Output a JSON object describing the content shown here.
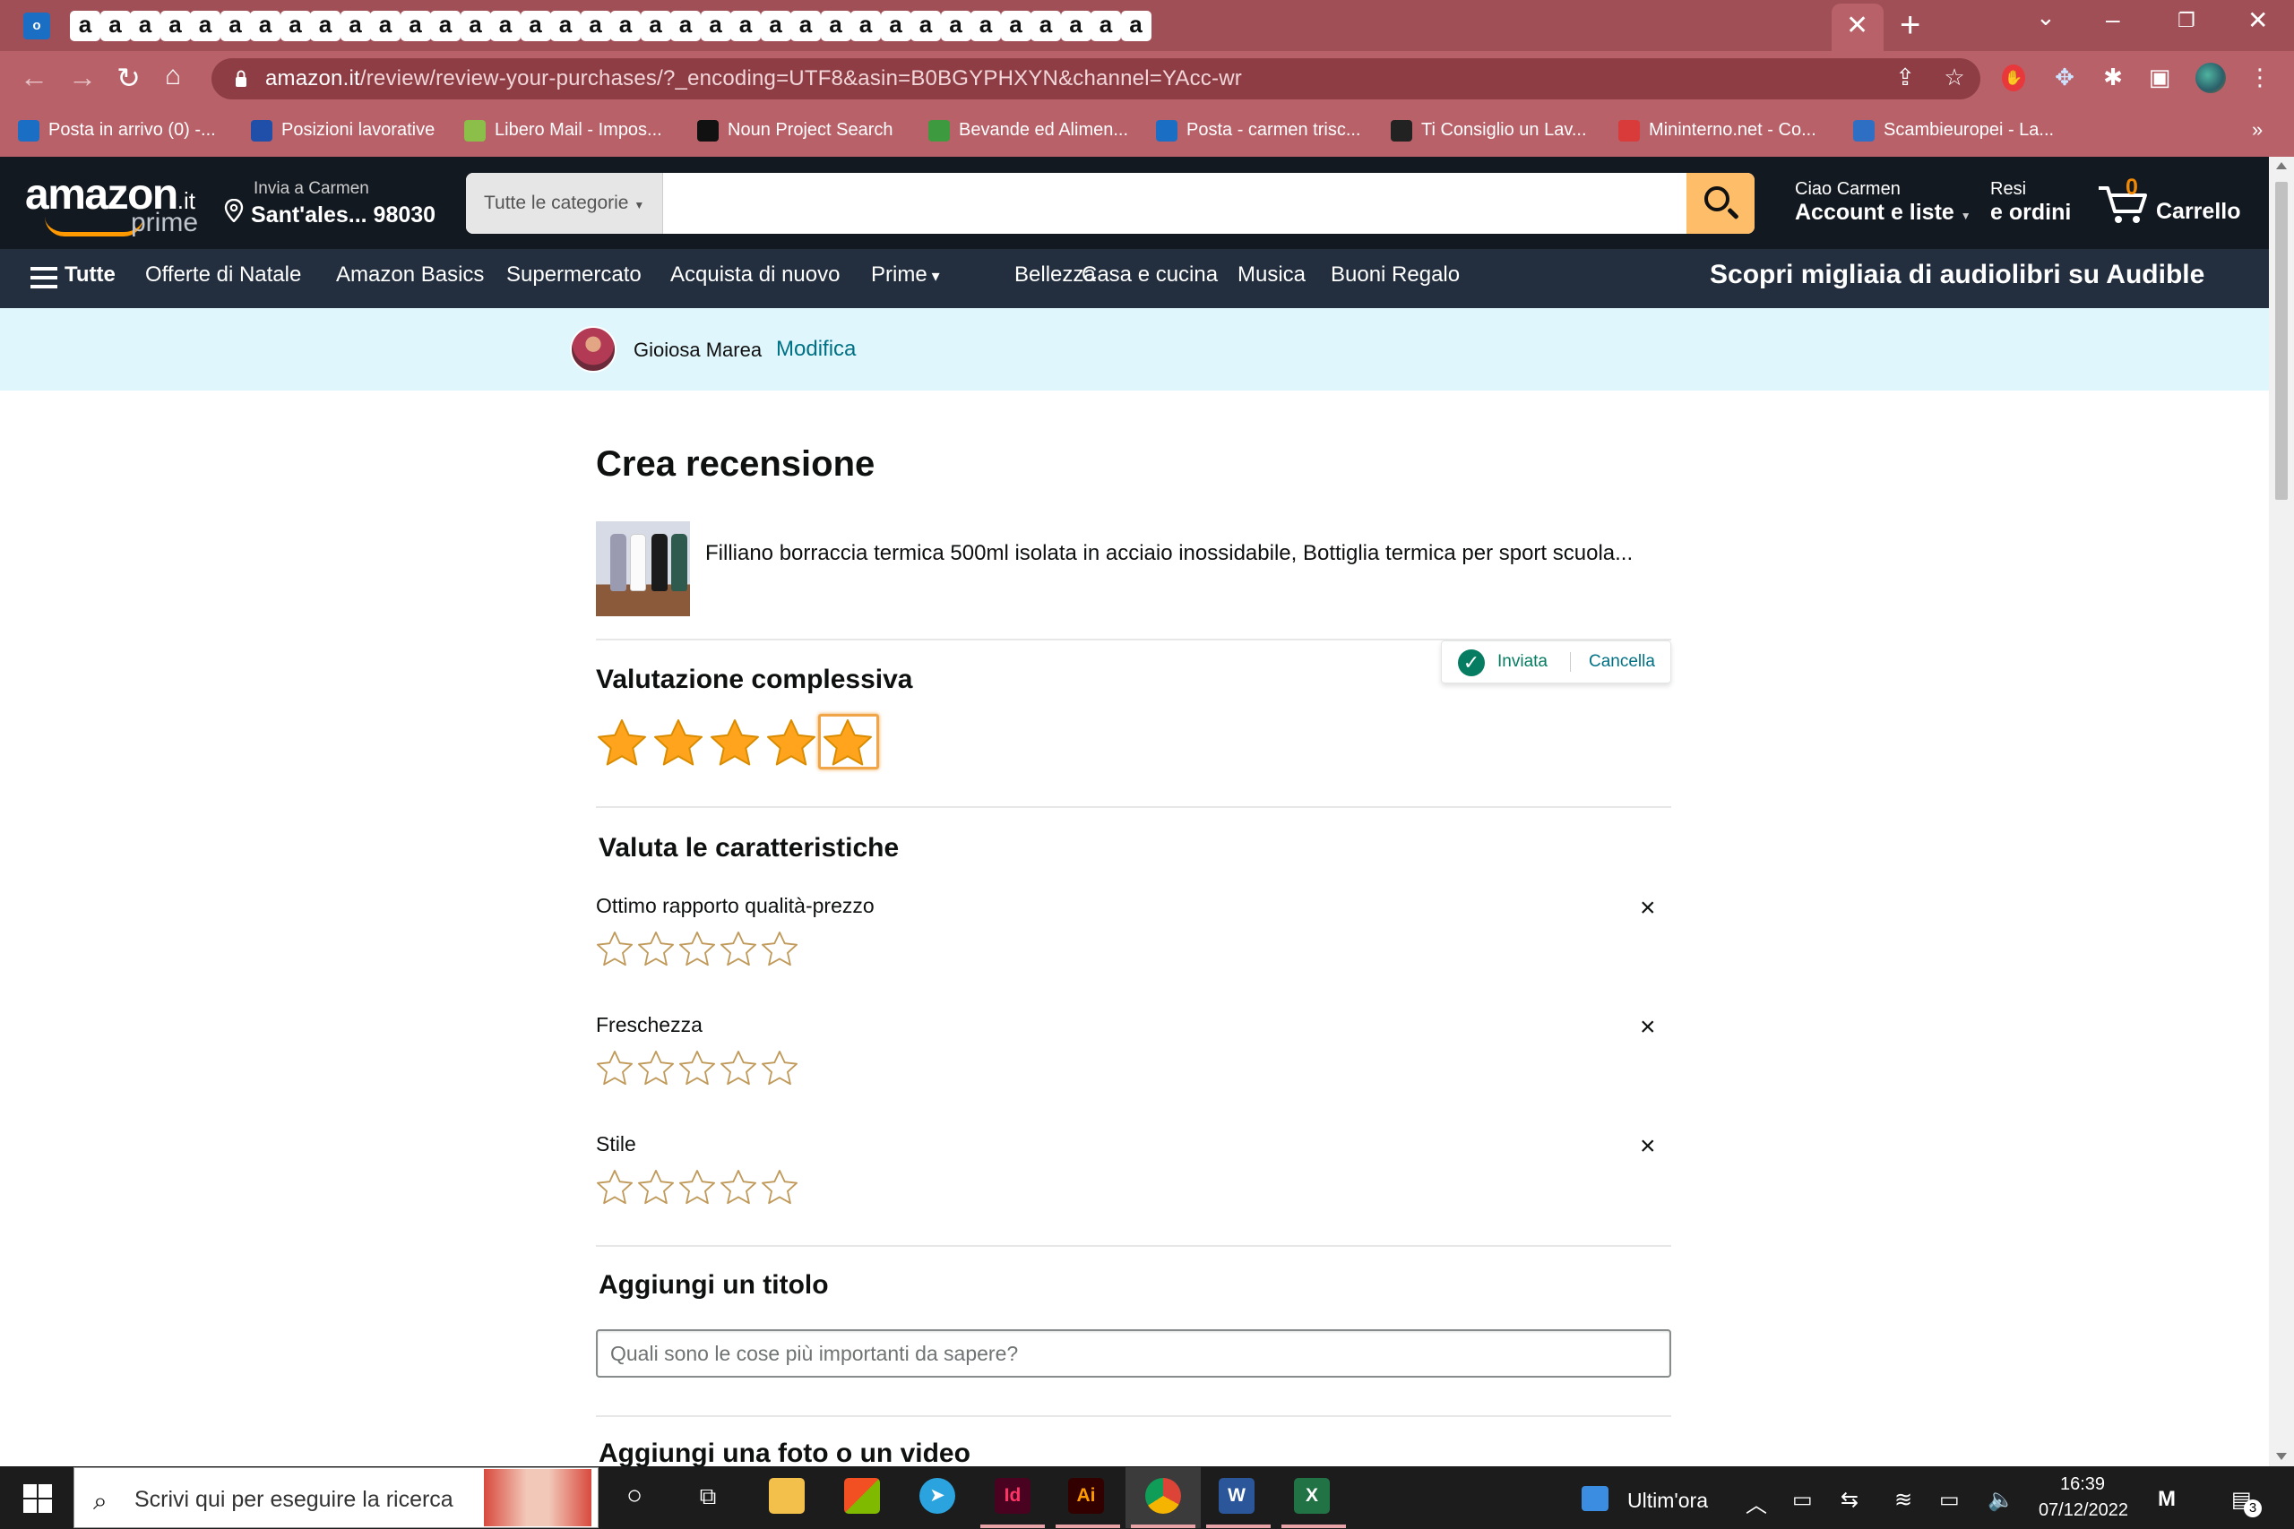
{
  "browser": {
    "tab_letter": "a",
    "tab_count": 36,
    "url_host": "amazon.it",
    "url_path": "/review/review-your-purchases/?_encoding=UTF8&asin=B0BGYPHXYN&channel=YAcc-wr",
    "bookmarks": [
      {
        "label": "Posta in arrivo (0) -...",
        "color": "#1a6fc4"
      },
      {
        "label": "Posizioni lavorative",
        "color": "#1f4fa8"
      },
      {
        "label": "Libero Mail - Impos...",
        "color": "#8bbf4a"
      },
      {
        "label": "Noun Project Search",
        "color": "#111111"
      },
      {
        "label": "Bevande ed Alimen...",
        "color": "#3e9a3e"
      },
      {
        "label": "Posta - carmen trisc...",
        "color": "#1a6fc4"
      },
      {
        "label": "Ti Consiglio un Lav...",
        "color": "#222222"
      },
      {
        "label": "Mininterno.net - Co...",
        "color": "#d93a3a"
      },
      {
        "label": "Scambieuropei - La...",
        "color": "#2e6fc4"
      }
    ],
    "bookmarks_overflow": "»"
  },
  "header": {
    "logo_word": "amazon",
    "logo_tld": ".it",
    "logo_prime": "prime",
    "deliver_line1": "Invia a Carmen",
    "deliver_line2": "Sant'ales... 98030",
    "search_category": "Tutte le categorie",
    "search_value": "",
    "account_line1": "Ciao Carmen",
    "account_line2": "Account e liste",
    "orders_line1": "Resi",
    "orders_line2": "e ordini",
    "cart_count": "0",
    "cart_label": "Carrello"
  },
  "nav": {
    "all": "Tutte",
    "items": [
      "Offerte di Natale",
      "Amazon Basics",
      "Supermercato",
      "Acquista di nuovo",
      "Prime",
      "Bellezza",
      "Casa e cucina",
      "Musica",
      "Buoni Regalo"
    ],
    "promo": "Scopri migliaia di audiolibri su Audible"
  },
  "profile": {
    "name": "Gioiosa Marea",
    "edit": "Modifica"
  },
  "review": {
    "page_title": "Crea recensione",
    "product_title": "Filliano borraccia termica 500ml isolata in acciaio inossidabile, Bottiglia termica per sport scuola...",
    "overall_heading": "Valutazione complessiva",
    "overall_rating": 5,
    "overall_max": 5,
    "status_sent": "Inviata",
    "status_cancel": "Cancella",
    "features_heading": "Valuta le caratteristiche",
    "features": [
      {
        "label": "Ottimo rapporto qualità-prezzo",
        "rating": 0
      },
      {
        "label": "Freschezza",
        "rating": 0
      },
      {
        "label": "Stile",
        "rating": 0
      }
    ],
    "title_heading": "Aggiungi un titolo",
    "title_placeholder": "Quali sono le cose più importanti da sapere?",
    "media_heading": "Aggiungi una foto o un video"
  },
  "taskbar": {
    "search_placeholder": "Scrivi qui per eseguire la ricerca",
    "news": "Ultim'ora",
    "time": "16:39",
    "date": "07/12/2022",
    "notifications": "3"
  },
  "colors": {
    "chrome_frame": "#a04f57",
    "amazon_dark": "#131921",
    "amazon_nav": "#232f3e",
    "search_orange": "#febd69",
    "star_fill": "#ffa41c",
    "link": "#007185",
    "success": "#067d62"
  }
}
